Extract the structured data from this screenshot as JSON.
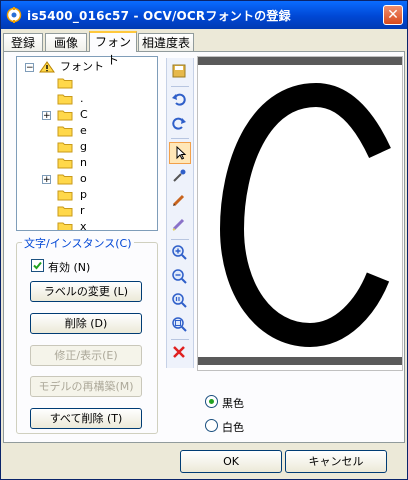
{
  "window": {
    "title": "is5400_016c57 - OCV/OCRフォントの登録"
  },
  "tabs": [
    {
      "label": "登録",
      "active": false
    },
    {
      "label": "画像",
      "active": false
    },
    {
      "label": "フォント",
      "active": true
    },
    {
      "label": "相違度表",
      "active": false
    }
  ],
  "tree": {
    "root": {
      "label": "フォント",
      "expanded": true
    },
    "items": [
      {
        "label": "",
        "expandable": false
      },
      {
        "label": ".",
        "expandable": false
      },
      {
        "label": "C",
        "expandable": true
      },
      {
        "label": "e",
        "expandable": false
      },
      {
        "label": "g",
        "expandable": false
      },
      {
        "label": "n",
        "expandable": false
      },
      {
        "label": "o",
        "expandable": true
      },
      {
        "label": "p",
        "expandable": false
      },
      {
        "label": "r",
        "expandable": false
      },
      {
        "label": "x",
        "expandable": false
      }
    ]
  },
  "instance_group": {
    "title": "文字/インスタンス(C)",
    "enabled_checkbox": {
      "label": "有効 (N)",
      "checked": true
    },
    "buttons": {
      "rename": "ラベルの変更 (L)",
      "delete": "削除 (D)",
      "edit_view": "修正/表示(E)",
      "rebuild_model": "モデルの再構築(M)",
      "delete_all": "すべて削除 (T)"
    }
  },
  "toolbar": {
    "tools": [
      "save-icon",
      "undo-icon",
      "redo-icon",
      "pointer-icon",
      "eyedropper-icon",
      "pen-icon",
      "eraser-icon",
      "zoom-in-icon",
      "zoom-out-icon",
      "zoom-actual-icon",
      "zoom-fit-icon",
      "delete-icon"
    ],
    "active_tool": "pointer-icon"
  },
  "canvas": {
    "glyph": "C"
  },
  "color_options": [
    {
      "label": "黒色",
      "selected": true
    },
    {
      "label": "白色",
      "selected": false
    }
  ],
  "footer": {
    "ok_label": "OK",
    "cancel_label": "キャンセル"
  }
}
